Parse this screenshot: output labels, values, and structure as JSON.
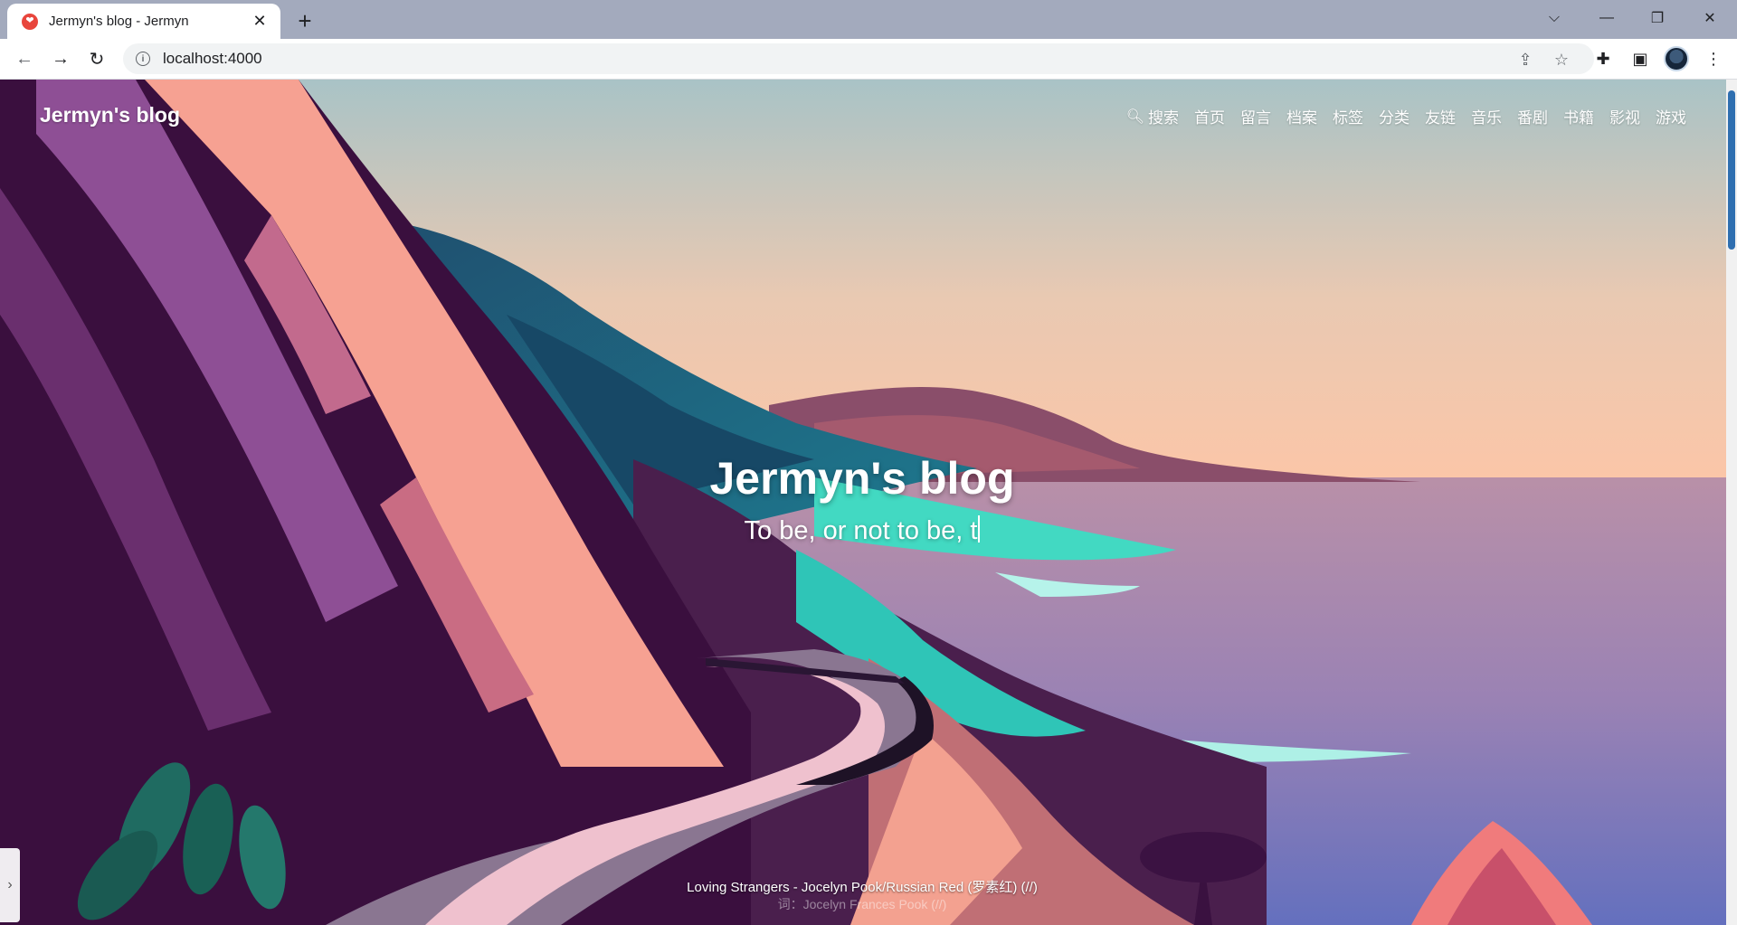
{
  "browser": {
    "tab": {
      "title": "Jermyn's blog - Jermyn",
      "favicon": "heart-icon"
    },
    "url": "localhost:4000"
  },
  "site": {
    "brand": "Jermyn's blog",
    "nav": {
      "search": "搜索",
      "items": [
        "首页",
        "留言",
        "档案",
        "标签",
        "分类",
        "友链",
        "音乐",
        "番剧",
        "书籍",
        "影视",
        "游戏"
      ]
    },
    "hero": {
      "title": "Jermyn's blog",
      "subtitle": "To be, or not to be, t"
    },
    "lyrics": {
      "line1": "Loving Strangers - Jocelyn Pook/Russian Red (罗素红) (//)",
      "line2": "词：Jocelyn Frances Pook (//)"
    }
  },
  "colors": {
    "tabstrip": "#a3aabd",
    "sky_top": "#a9c3c6",
    "sky_bottom": "#fbc6a8",
    "sea": "#6f74bf",
    "cliff_dark": "#3a0f3e",
    "cliff_pink": "#f6a192",
    "teal_hill": "#1e6f8a",
    "scroll_thumb": "#2f6fb0"
  }
}
